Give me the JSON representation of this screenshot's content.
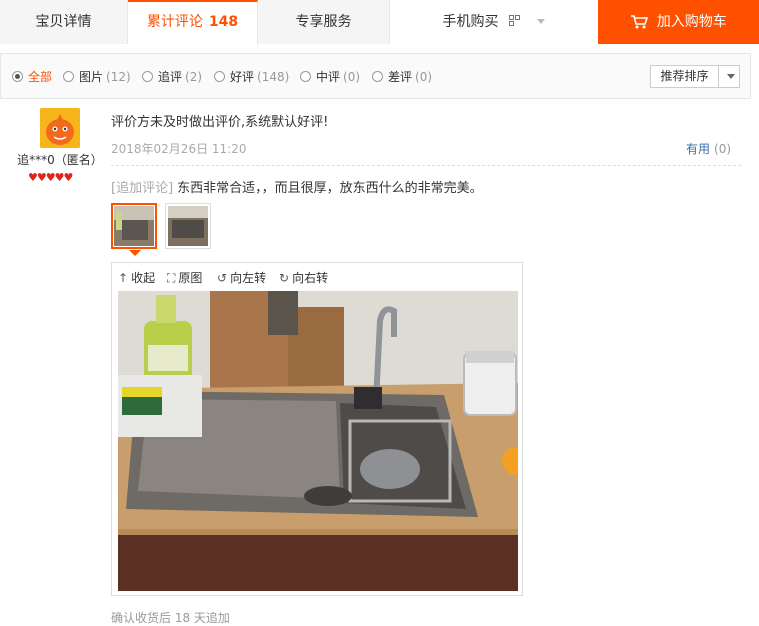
{
  "tabs": {
    "details": "宝贝详情",
    "reviews": "累计评论",
    "reviews_count": "148",
    "service": "专享服务",
    "mobile": "手机购买"
  },
  "cart_button": "加入购物车",
  "filters": [
    {
      "label": "全部",
      "count": "",
      "active": true
    },
    {
      "label": "图片",
      "count": "(12)"
    },
    {
      "label": "追评",
      "count": "(2)"
    },
    {
      "label": "好评",
      "count": "(148)"
    },
    {
      "label": "中评",
      "count": "(0)"
    },
    {
      "label": "差评",
      "count": "(0)"
    }
  ],
  "sort_label": "推荐排序",
  "review": {
    "username": "追***0（匿名）",
    "content": "评价方未及时做出评价,系统默认好评!",
    "date": "2018年02月26日 11:20",
    "useful_label": "有用",
    "useful_count": "(0)",
    "append_tag": "[追加评论]",
    "append_text": "东西非常合适，，而且很厚，放东西什么的非常完美。",
    "hearts": 5,
    "footnote": "确认收货后 18 天追加"
  },
  "viewer": {
    "collapse": "收起",
    "original": "原图",
    "rotate_left": "向左转",
    "rotate_right": "向右转"
  },
  "colors": {
    "accent": "#ff5000",
    "link": "#3a6ea5",
    "heart": "#e2231a"
  }
}
